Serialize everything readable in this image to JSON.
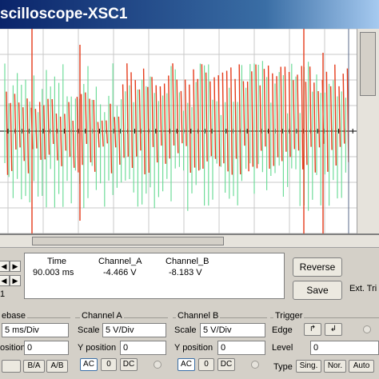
{
  "window": {
    "title": "scilloscope-XSC1"
  },
  "colors": {
    "channel_a": "#e53a1a",
    "channel_b": "#6fdc9a",
    "grid": "#c8c8c8"
  },
  "icons": [
    "arrow-left-icon",
    "arrow-right-icon",
    "arrow-left-icon",
    "arrow-right-icon"
  ],
  "readout": {
    "cursor_label": "1",
    "headers": {
      "time": "Time",
      "channel_a": "Channel_A",
      "channel_b": "Channel_B"
    },
    "values": {
      "time": "90.003 ms",
      "channel_a": "-4.466 V",
      "channel_b": "-8.183 V"
    }
  },
  "buttons": {
    "reverse": "Reverse",
    "save": "Save",
    "ext_trigger": "Ext. Tri"
  },
  "timebase": {
    "title": "ebase",
    "scale_value": "5 ms/Div",
    "x_position_label": "osition",
    "x_position_value": "0",
    "modes": [
      "B/A",
      "A/B"
    ]
  },
  "channel_a": {
    "title": "Channel A",
    "scale_label": "Scale",
    "scale_value": "5  V/Div",
    "ypos_label": "Y position",
    "ypos_value": "0",
    "coupling": [
      "AC",
      "0",
      "DC"
    ],
    "selected_coupling": "AC"
  },
  "channel_b": {
    "title": "Channel B",
    "scale_label": "Scale",
    "scale_value": "5  V/Div",
    "ypos_label": "Y position",
    "ypos_value": "0",
    "coupling": [
      "AC",
      "0",
      "DC"
    ],
    "selected_coupling": "AC"
  },
  "trigger": {
    "title": "Trigger",
    "edge_label": "Edge",
    "edge_buttons": [
      "rising-edge-icon",
      "falling-edge-icon"
    ],
    "level_label": "Level",
    "level_value": "0",
    "type_label": "Type",
    "types": [
      "Sing.",
      "Nor.",
      "Auto"
    ]
  }
}
